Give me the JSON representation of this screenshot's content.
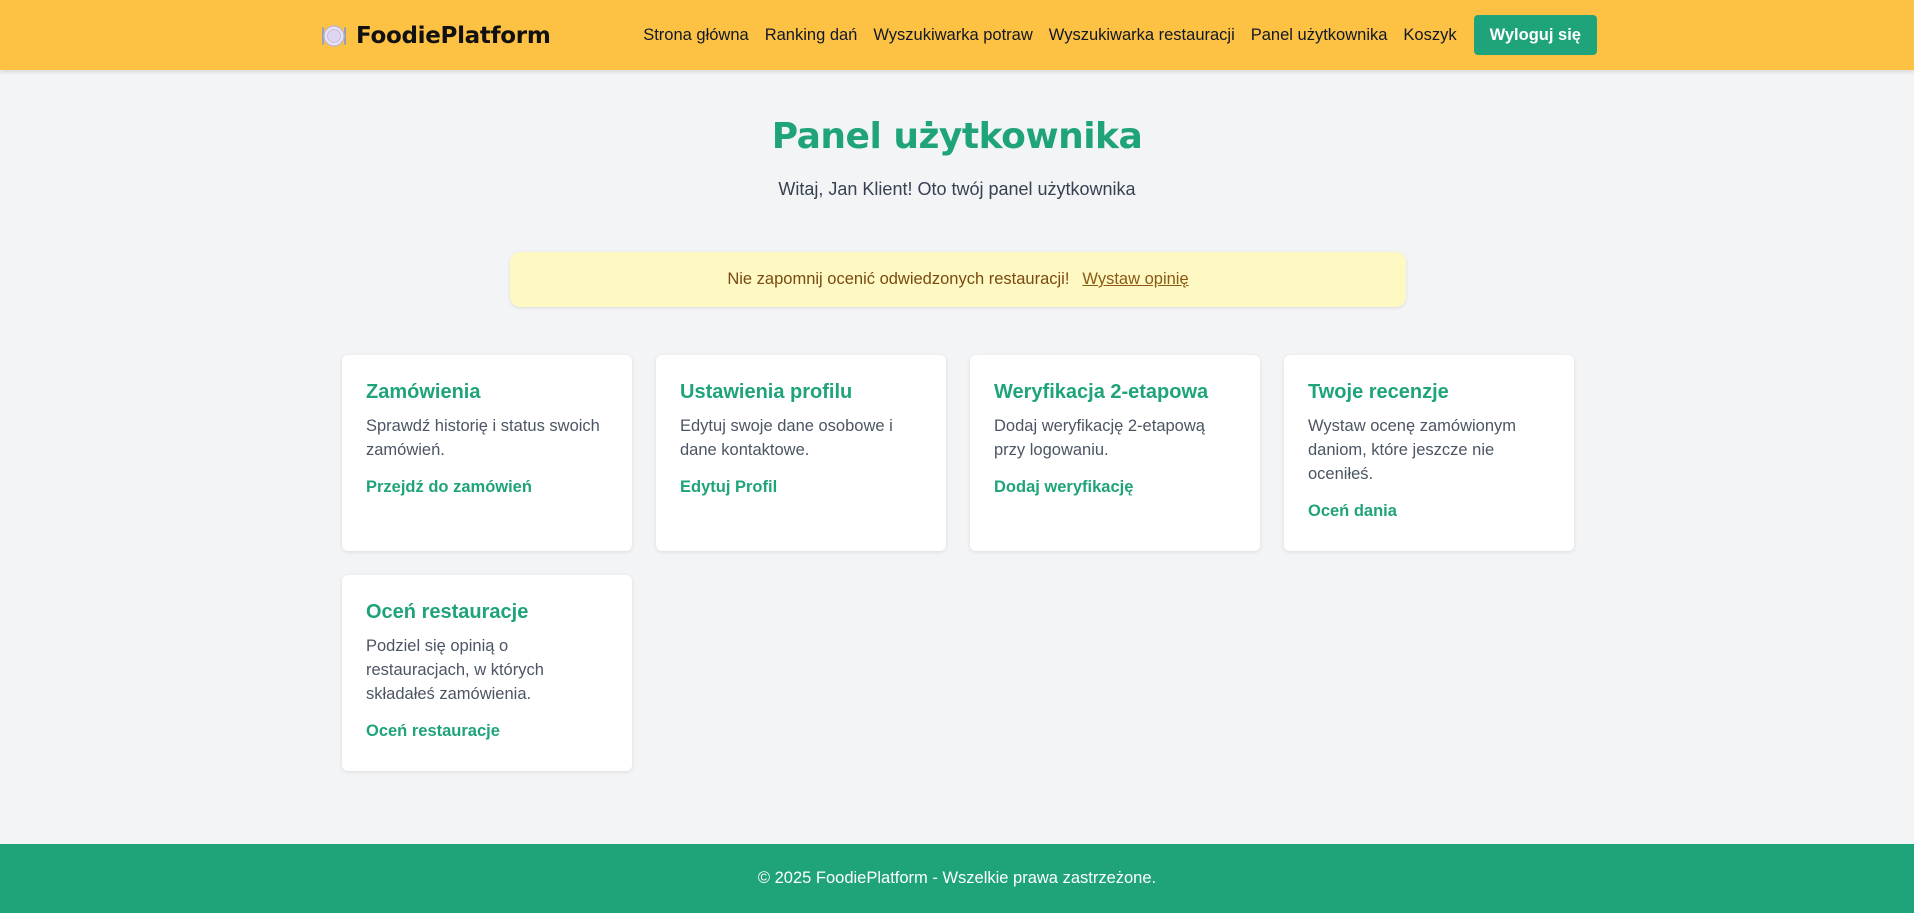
{
  "header": {
    "logo_icon": "plate-icon",
    "logo_text": "FoodiePlatform",
    "nav": [
      {
        "label": "Strona główna"
      },
      {
        "label": "Ranking dań"
      },
      {
        "label": "Wyszukiwarka potraw"
      },
      {
        "label": "Wyszukiwarka restauracji"
      },
      {
        "label": "Panel użytkownika"
      },
      {
        "label": "Koszyk"
      }
    ],
    "logout_label": "Wyloguj się"
  },
  "main": {
    "title": "Panel użytkownika",
    "subtitle": "Witaj, Jan Klient! Oto twój panel użytkownika",
    "notice": {
      "text": "Nie zapomnij ocenić odwiedzonych restauracji!",
      "link": "Wystaw opinię"
    },
    "cards": [
      {
        "title": "Zamówienia",
        "desc": "Sprawdź historię i status swoich zamówień.",
        "link": "Przejdź do zamówień"
      },
      {
        "title": "Ustawienia profilu",
        "desc": "Edytuj swoje dane osobowe i dane kontaktowe.",
        "link": "Edytuj Profil"
      },
      {
        "title": "Weryfikacja 2-etapowa",
        "desc": "Dodaj weryfikację 2-etapową przy logowaniu.",
        "link": "Dodaj weryfikację"
      },
      {
        "title": "Twoje recenzje",
        "desc": "Wystaw ocenę zamówionym daniom, które jeszcze nie oceniłeś.",
        "link": "Oceń dania"
      },
      {
        "title": "Oceń restauracje",
        "desc": "Podziel się opinią o restauracjach, w których składałeś zamówienia.",
        "link": "Oceń restauracje"
      }
    ]
  },
  "footer": {
    "text": "© 2025 FoodiePlatform - Wszelkie prawa zastrzeżone."
  },
  "colors": {
    "header_bg": "#fdc243",
    "accent_green": "#1fa37a",
    "page_bg": "#f3f4f6",
    "notice_bg": "#fef8c3",
    "notice_text": "#7a4a12"
  }
}
